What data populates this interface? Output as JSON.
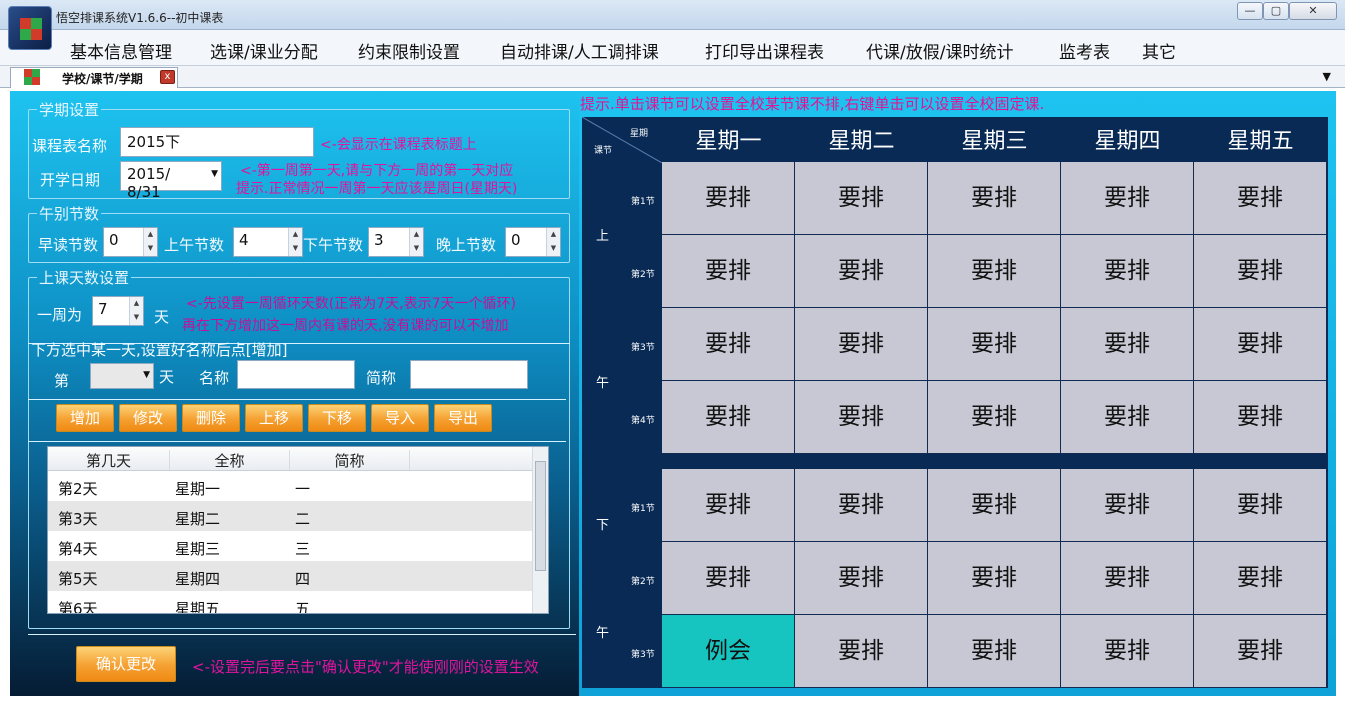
{
  "window": {
    "title": "悟空排课系统V1.6.6--初中课表",
    "controls": [
      "—",
      "▢",
      "✕"
    ]
  },
  "menu": [
    "基本信息管理",
    "选课/课业分配",
    "约束限制设置",
    "自动排课/人工调排课",
    "打印导出课程表",
    "代课/放假/课时统计",
    "监考表",
    "其它"
  ],
  "tab": {
    "label": "学校/课节/学期",
    "close": "x",
    "dropdown": "▼"
  },
  "hint_top": "提示.单击课节可以设置全校某节课不排,右键单击可以设置全校固定课.",
  "term": {
    "legend": "学期设置",
    "name_label": "课程表名称",
    "name_value": "2015下",
    "name_hint": "<-会显示在课程表标题上",
    "start_label": "开学日期",
    "start_value": "2015/  8/31",
    "start_hint1": "<-第一周第一天,请与下方一周的第一天对应",
    "start_hint2": "提示.正常情况一周第一天应该是周日(星期天)"
  },
  "periods": {
    "legend": "午别节数",
    "morning_read_label": "早读节数",
    "morning_read_value": "0",
    "am_label": "上午节数",
    "am_value": "4",
    "pm_label": "下午节数",
    "pm_value": "3",
    "eve_label": "晚上节数",
    "eve_value": "0"
  },
  "days": {
    "legend": "上课天数设置",
    "week_label": "一周为",
    "week_value": "7",
    "week_unit": "天",
    "hint1": "<-先设置一周循环天数(正常为7天,表示7天一个循环)",
    "hint2": "再在下方增加这一周内有课的天,没有课的可以不增加",
    "select_hint": "下方选中某一天,设置好名称后点[增加]",
    "nth_label": "第",
    "nth_unit": "天",
    "fullname_label": "名称",
    "short_label": "简称",
    "buttons": [
      "增加",
      "修改",
      "删除",
      "上移",
      "下移",
      "导入",
      "导出"
    ],
    "columns": [
      "第几天",
      "全称",
      "简称"
    ],
    "rows": [
      [
        "第2天",
        "星期一",
        "一"
      ],
      [
        "第3天",
        "星期二",
        "二"
      ],
      [
        "第4天",
        "星期三",
        "三"
      ],
      [
        "第5天",
        "星期四",
        "四"
      ],
      [
        "第6天",
        "星期五",
        "五"
      ]
    ]
  },
  "confirm": {
    "label": "确认更改",
    "hint": "<-设置完后要点击\"确认更改\"才能使刚刚的设置生效"
  },
  "schedule": {
    "corner_day": "星期",
    "corner_slot": "课节",
    "days": [
      "星期一",
      "星期二",
      "星期三",
      "星期四",
      "星期五"
    ],
    "am_side": [
      "上",
      "午"
    ],
    "pm_side": [
      "下",
      "午"
    ],
    "am_slots": [
      "第1节",
      "第2节",
      "第3节",
      "第4节"
    ],
    "pm_slots": [
      "第1节",
      "第2节",
      "第3节"
    ],
    "am_cells": [
      [
        "要排",
        "要排",
        "要排",
        "要排",
        "要排"
      ],
      [
        "要排",
        "要排",
        "要排",
        "要排",
        "要排"
      ],
      [
        "要排",
        "要排",
        "要排",
        "要排",
        "要排"
      ],
      [
        "要排",
        "要排",
        "要排",
        "要排",
        "要排"
      ]
    ],
    "pm_cells": [
      [
        "要排",
        "要排",
        "要排",
        "要排",
        "要排"
      ],
      [
        "要排",
        "要排",
        "要排",
        "要排",
        "要排"
      ],
      [
        "例会",
        "要排",
        "要排",
        "要排",
        "要排"
      ]
    ],
    "colors": {
      "normal": "#c8c8d4",
      "meeting": "#17c5c0",
      "header": "#082a55"
    }
  }
}
